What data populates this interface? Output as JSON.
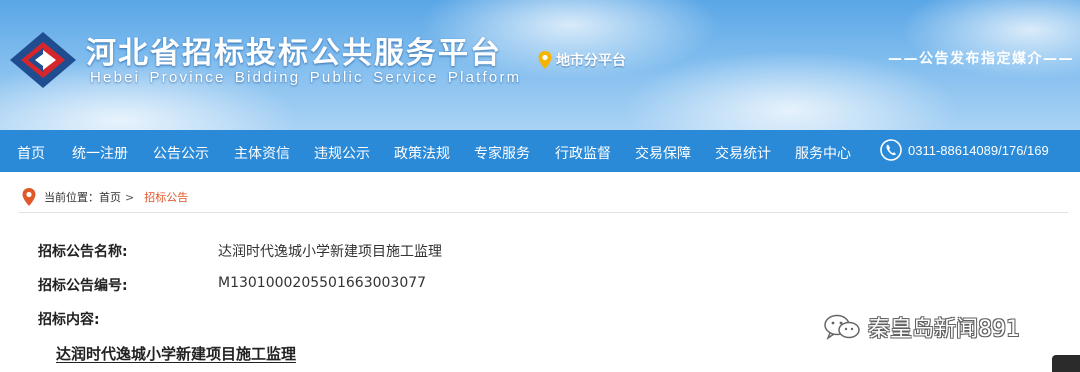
{
  "header": {
    "title_cn": "河北省招标投标公共服务平台",
    "title_en": "Hebei Province Bidding Public Service Platform",
    "sub_platform": "地市分平台",
    "media_slogan": "——公告发布指定媒介——"
  },
  "nav": {
    "items": [
      "首页",
      "统一注册",
      "公告公示",
      "主体资信",
      "违规公示",
      "政策法规",
      "专家服务",
      "行政监督",
      "交易保障",
      "交易统计",
      "服务中心"
    ],
    "phone": "0311-88614089/176/169"
  },
  "breadcrumb": {
    "prefix": "当前位置：",
    "home": "首页",
    "separator": ">",
    "current": "招标公告"
  },
  "notice": {
    "name_label": "招标公告名称:",
    "name_value": "达润时代逸城小学新建项目施工监理",
    "code_label": "招标公告编号:",
    "code_value": "M1301000205501663003077",
    "content_label": "招标内容:",
    "doc_title": "达润时代逸城小学新建项目施工监理"
  },
  "watermark": {
    "text": "秦皇岛新闻891"
  },
  "colors": {
    "nav_bg": "#2b8ad8",
    "accent_orange": "#e0572a",
    "pin_yellow": "#f5b400"
  },
  "icons": {
    "logo": "diamond-logo-icon",
    "location": "location-pin-icon",
    "phone": "phone-icon",
    "wechat": "wechat-icon"
  }
}
